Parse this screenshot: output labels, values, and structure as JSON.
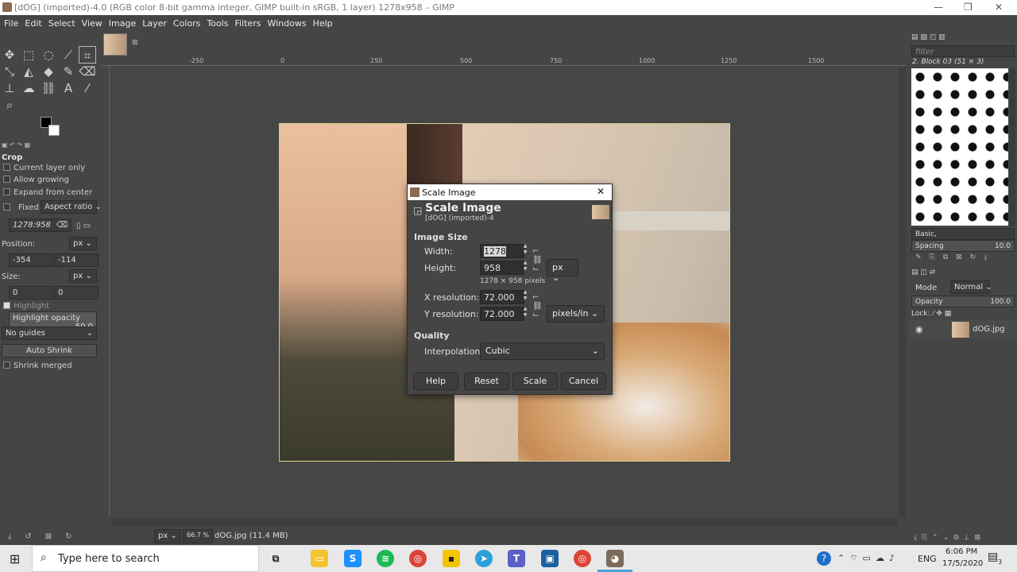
{
  "window": {
    "title": "[dOG] (imported)-4.0 (RGB color 8-bit gamma integer, GIMP built-in sRGB, 1 layer) 1278x958 – GIMP",
    "minimize": "—",
    "maximize": "❐",
    "close": "✕"
  },
  "menu": [
    "File",
    "Edit",
    "Select",
    "View",
    "Image",
    "Layer",
    "Colors",
    "Tools",
    "Filters",
    "Windows",
    "Help"
  ],
  "tool_options": {
    "title": "Crop",
    "current_layer_only": "Current layer only",
    "allow_growing": "Allow growing",
    "expand_from_center": "Expand from center",
    "fixed_label": "Fixed",
    "fixed_mode": "Aspect ratio",
    "ratio_value": "1278:958",
    "position_label": "Position:",
    "position_unit": "px",
    "position_x": "-354",
    "position_y": "-114",
    "size_label": "Size:",
    "size_unit": "px",
    "size_w": "0",
    "size_h": "0",
    "highlight": "Highlight",
    "highlight_opacity_label": "Highlight opacity",
    "highlight_opacity_value": "50.0",
    "guides": "No guides",
    "auto_shrink": "Auto Shrink",
    "shrink_merged": "Shrink merged"
  },
  "ruler": {
    "marks": [
      "-250",
      "0",
      "250",
      "500",
      "750",
      "1000",
      "1250",
      "1500"
    ]
  },
  "status": {
    "unit": "px",
    "zoom": "66.7 %",
    "file": "dOG.jpg (11.4 MB)"
  },
  "right_panel": {
    "filter_placeholder": "filter",
    "brush_name": "2. Block 03 (51 × 3)",
    "preset": "Basic,",
    "spacing_label": "Spacing",
    "spacing_value": "10.0",
    "mode_label": "Mode",
    "mode_value": "Normal",
    "opacity_label": "Opacity",
    "opacity_value": "100.0",
    "lock_label": "Lock:",
    "layer_name": "dOG.jpg"
  },
  "dialog": {
    "title": "Scale Image",
    "header": "Scale Image",
    "subheader": "[dOG] (imported)-4",
    "image_size": "Image Size",
    "width_label": "Width:",
    "width_value": "1278",
    "height_label": "Height:",
    "height_value": "958",
    "size_unit": "px",
    "pixels_note": "1278 × 958 pixels",
    "xres_label": "X resolution:",
    "xres_value": "72.000",
    "yres_label": "Y resolution:",
    "yres_value": "72.000",
    "res_unit": "pixels/in",
    "quality": "Quality",
    "interp_label": "Interpolation:",
    "interp_value": "Cubic",
    "help": "Help",
    "reset": "Reset",
    "scale": "Scale",
    "cancel": "Cancel"
  },
  "taskbar": {
    "search_placeholder": "Type here to search",
    "time": "6:06 PM",
    "date": "17/5/2020",
    "lang": "ENG",
    "notifications": "3"
  }
}
